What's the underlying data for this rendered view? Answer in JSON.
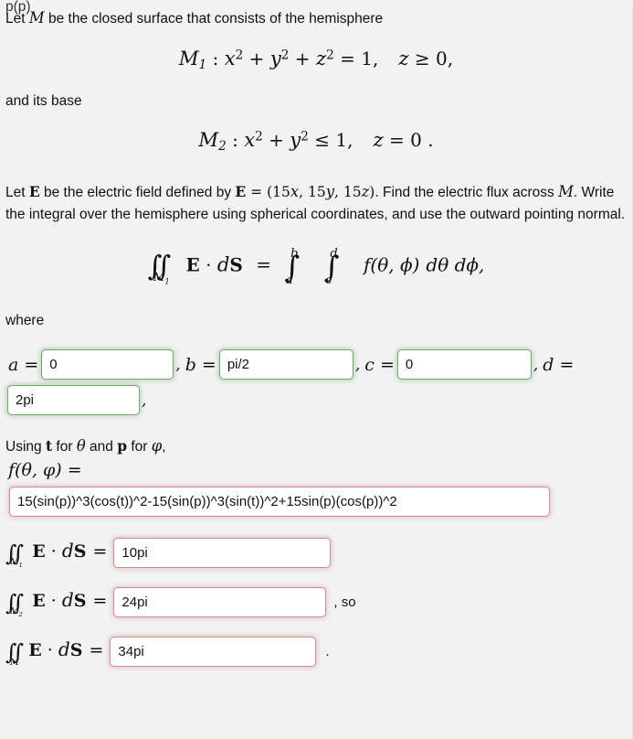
{
  "background_color": "#f2f2f2",
  "border_colors": {
    "correct_green": "#72a672",
    "incorrect_red": "#d38c8c"
  },
  "clipped_top_text": "p(p)",
  "problem": {
    "intro_line": "Let M be the closed surface that consists of the hemisphere",
    "intro_prefix": "Let ",
    "intro_var": "M",
    "intro_suffix": " be the closed surface that consists of the hemisphere",
    "eq_m1": {
      "name": "M",
      "sub": "1",
      "colon": " : ",
      "body": "x2 + y2 + z2 = 1,",
      "cond": "z ≥ 0,"
    },
    "base_line": "and its base",
    "eq_m2": {
      "name": "M",
      "sub": "2",
      "colon": " : ",
      "body": "x2 + y2 ≤ 1,",
      "cond": "z = 0 ."
    },
    "field_para_1": "Let ",
    "field_bold_e": "E",
    "field_para_2": " be the electric field defined by ",
    "field_bold_e2": "E",
    "field_para_3": " = (15x, 15y, 15z). Find the electric flux across ",
    "field_var_m": "M",
    "field_para_4": ". Write the integral over the hemisphere using spherical coordinates, and use the outward pointing normal.",
    "where_label": "where",
    "using_prefix": "Using ",
    "using_t": "t",
    "using_mid1": " for ",
    "using_theta": "θ",
    "using_mid2": " and ",
    "using_p": "p",
    "using_mid3": " for ",
    "using_phi": "φ",
    "using_suffix": ","
  },
  "display_equation": {
    "lhs_integral_sub": "M1",
    "lhs_body": "E · dS",
    "equals": "=",
    "int1_upper": "b",
    "int1_lower": "a",
    "int2_upper": "d",
    "int2_lower": "c",
    "integrand": "f(θ, φ) dθ dφ,"
  },
  "limits": {
    "a_label": "a",
    "a_value": "0",
    "a_status": "correct",
    "b_label": "b",
    "b_value": "pi/2",
    "b_status": "correct",
    "c_label": "c",
    "c_value": "0",
    "c_status": "correct",
    "d_label": "d",
    "d_value": "2pi",
    "d_status": "correct",
    "separator": ",",
    "equals": "="
  },
  "f_function": {
    "label": "f(θ, φ) =",
    "value": "15(sin(p))^3(cos(t))^2-15(sin(p))^3(sin(t))^2+15sin(p)(cos(p))^2",
    "status": "incorrect"
  },
  "flux_answers": [
    {
      "surface": "M1",
      "surface_sub": "1",
      "body": "E · dS",
      "equals": "=",
      "value": "10pi",
      "status": "incorrect",
      "trailing": ""
    },
    {
      "surface": "M2",
      "surface_sub": "2",
      "body": "E · dS",
      "equals": "=",
      "value": "24pi",
      "status": "incorrect",
      "trailing": ", so"
    },
    {
      "surface": "M",
      "surface_sub": "",
      "body": "E · dS",
      "equals": "=",
      "value": "34pi",
      "status": "incorrect",
      "trailing": "."
    }
  ]
}
